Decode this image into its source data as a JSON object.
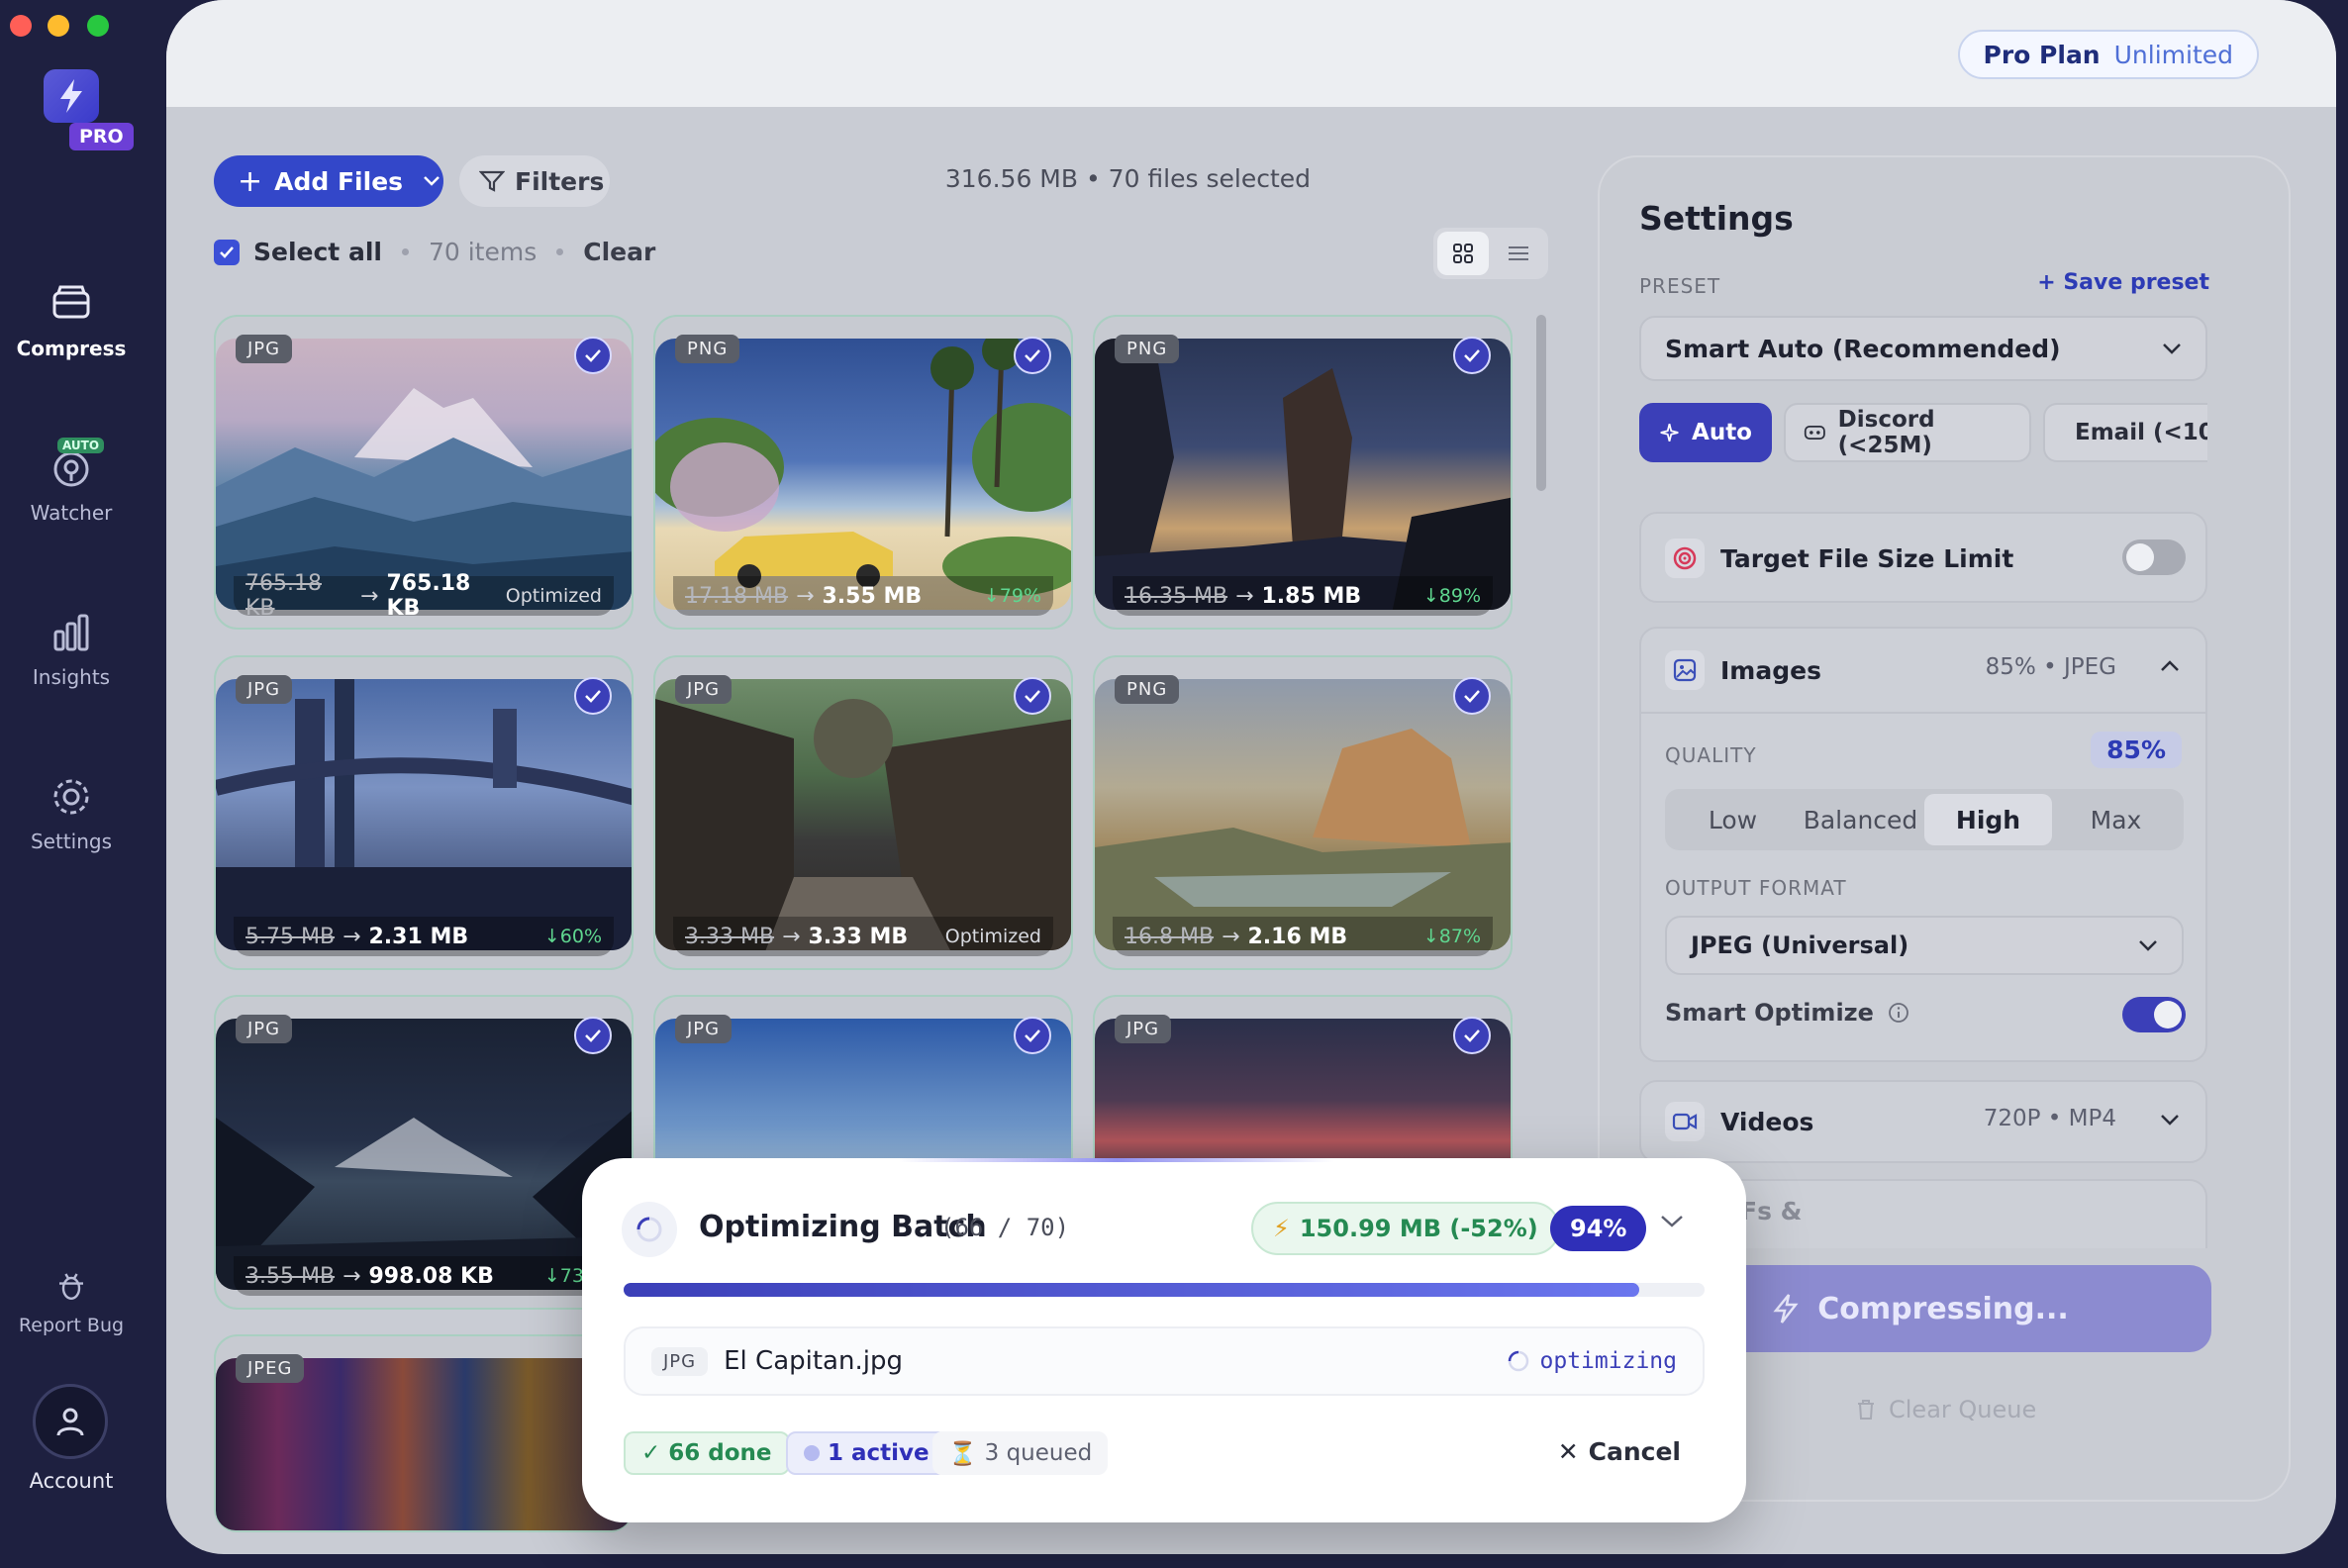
{
  "sidebar": {
    "pro_badge": "PRO",
    "items": [
      {
        "label": "Compress",
        "icon": "compress-icon",
        "active": true
      },
      {
        "label": "Watcher",
        "icon": "watcher-icon",
        "badge": "AUTO"
      },
      {
        "label": "Insights",
        "icon": "insights-icon"
      },
      {
        "label": "Settings",
        "icon": "gear-icon"
      }
    ],
    "report_bug": "Report Bug",
    "account": "Account"
  },
  "header": {
    "plan_name": "Pro Plan",
    "plan_tier": "Unlimited"
  },
  "toolbar": {
    "add_files": "Add Files",
    "filters": "Filters",
    "summary": "316.56 MB • 70 files selected",
    "select_all": "Select all",
    "item_count": "70 items",
    "clear": "Clear"
  },
  "files": [
    {
      "type": "JPG",
      "old": "765.18 KB",
      "new": "765.18 KB",
      "status": "Optimized"
    },
    {
      "type": "PNG",
      "old": "17.18 MB",
      "new": "3.55 MB",
      "saving": "↓79%"
    },
    {
      "type": "PNG",
      "old": "16.35 MB",
      "new": "1.85 MB",
      "saving": "↓89%"
    },
    {
      "type": "JPG",
      "old": "5.75 MB",
      "new": "2.31 MB",
      "saving": "↓60%"
    },
    {
      "type": "JPG",
      "old": "3.33 MB",
      "new": "3.33 MB",
      "status": "Optimized"
    },
    {
      "type": "PNG",
      "old": "16.8 MB",
      "new": "2.16 MB",
      "saving": "↓87%"
    },
    {
      "type": "JPG",
      "old": "3.55 MB",
      "new": "998.08 KB",
      "saving": "↓73%"
    },
    {
      "type": "JPG"
    },
    {
      "type": "JPG"
    },
    {
      "type": "JPEG"
    }
  ],
  "settings": {
    "title": "Settings",
    "preset_label": "PRESET",
    "save_preset": "Save preset",
    "preset_value": "Smart Auto (Recommended)",
    "preset_pills": [
      "Auto",
      "Discord (<25M)",
      "Email (<10"
    ],
    "target_size": "Target File Size Limit",
    "images": {
      "title": "Images",
      "meta": "85% • JPEG",
      "quality_label": "QUALITY",
      "quality_value": "85%",
      "quality_options": [
        "Low",
        "Balanced",
        "High",
        "Max"
      ],
      "quality_selected": "High",
      "format_label": "OUTPUT FORMAT",
      "format_value": "JPEG (Universal)",
      "smart_optimize": "Smart Optimize"
    },
    "videos": {
      "title": "Videos",
      "meta": "720P • MP4"
    },
    "next_section_partial": "Fs &",
    "compress_button": "Compressing...",
    "clear_queue": "Clear Queue"
  },
  "batch": {
    "title": "Optimizing Batch",
    "count": "(66 / 70)",
    "saved": "150.99 MB (-52%)",
    "percent": "94%",
    "progress": 0.94,
    "current_type": "JPG",
    "current_file": "El Capitan.jpg",
    "current_status": "optimizing",
    "done": "✓ 66 done",
    "active": "1 active",
    "queued": "3 queued",
    "cancel": "Cancel"
  },
  "colors": {
    "accent": "#3b3fb8",
    "success": "#258a52",
    "sidebar_bg": "#1e2040"
  }
}
